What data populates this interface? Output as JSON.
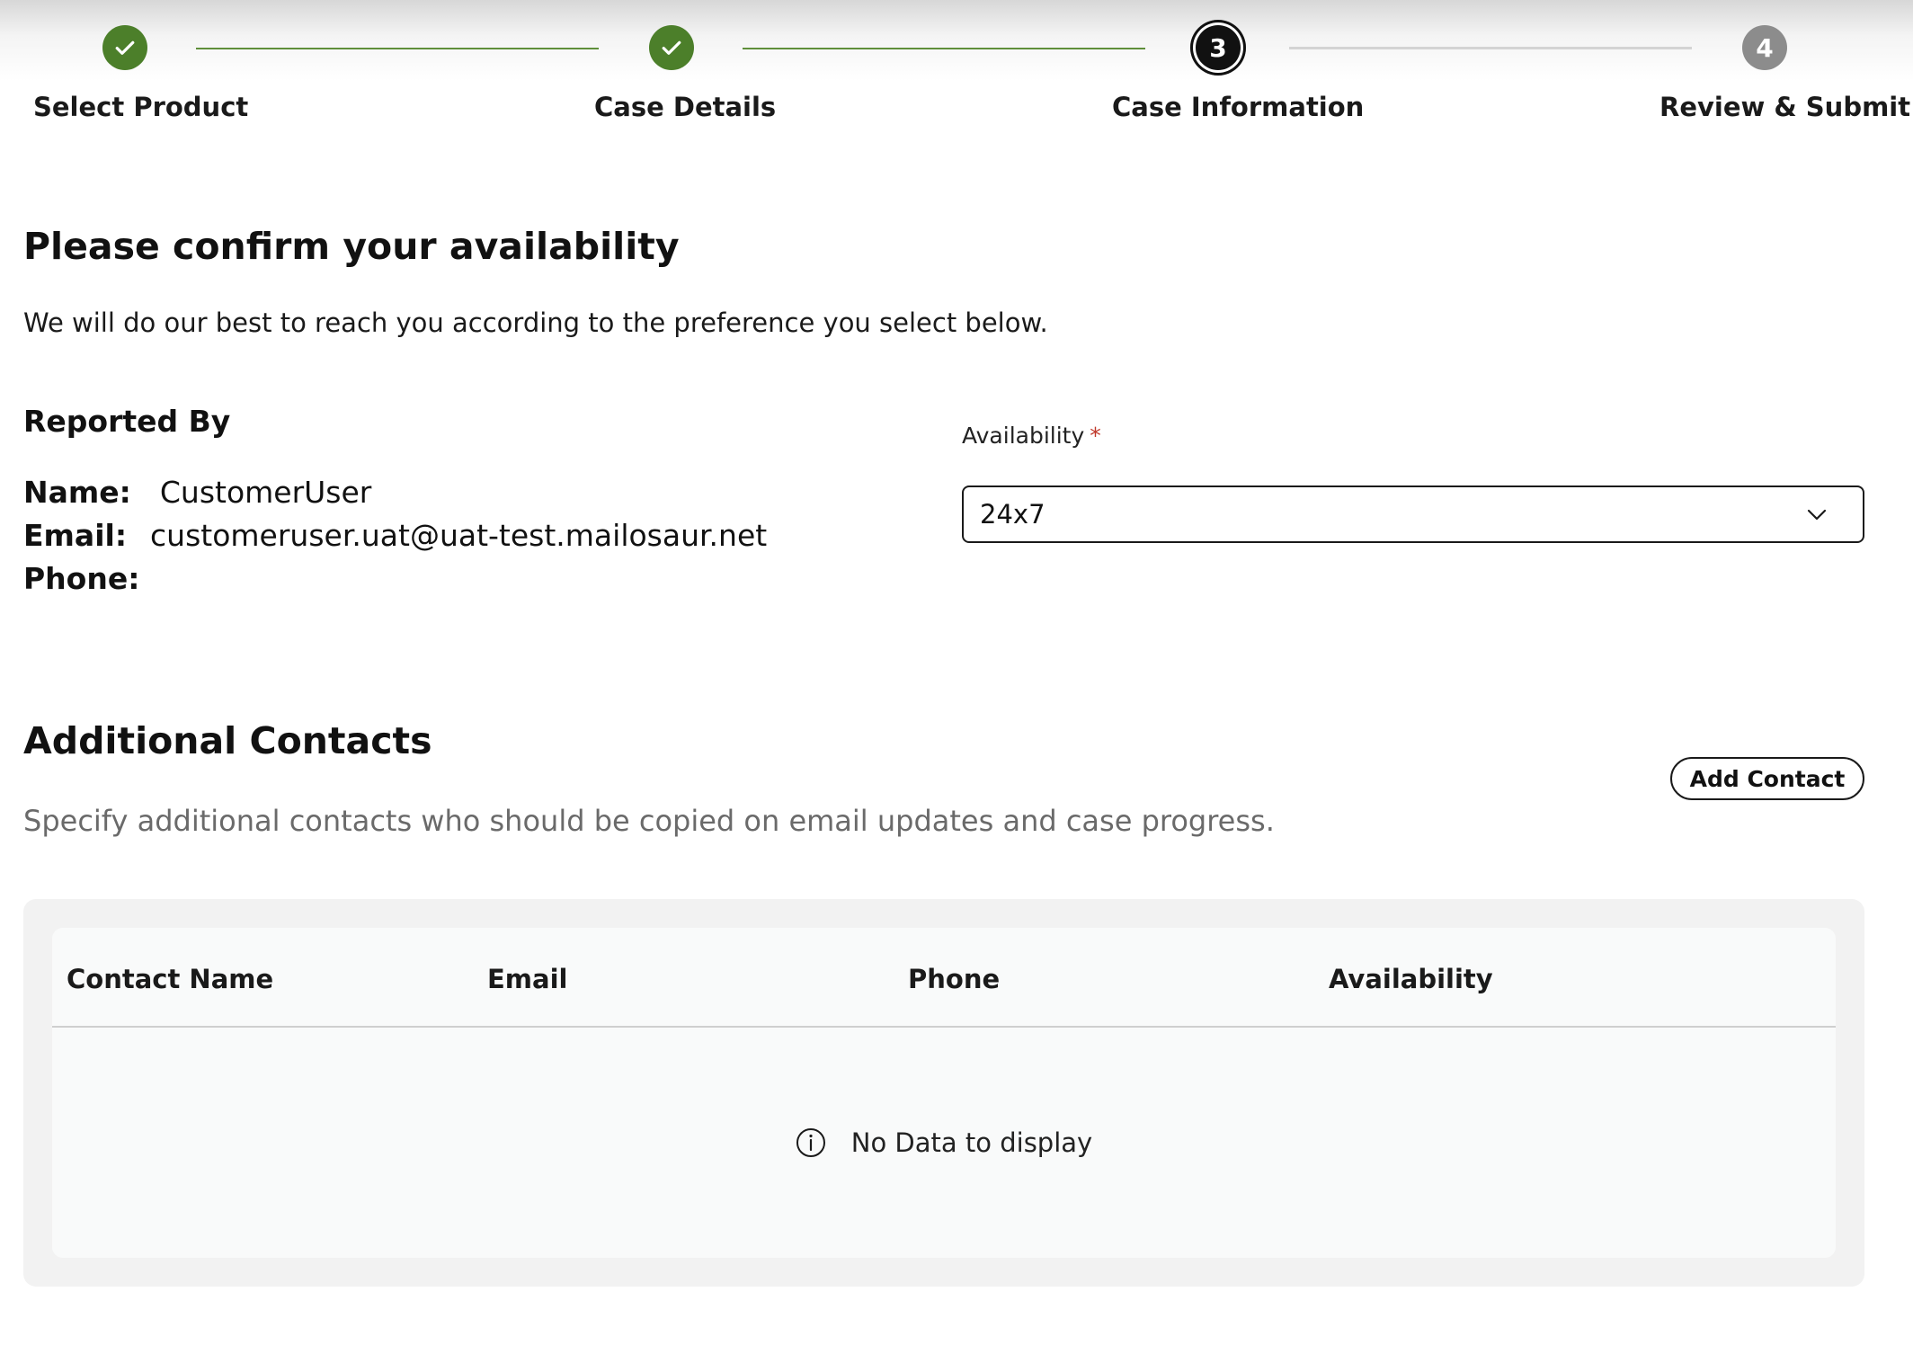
{
  "stepper": {
    "steps": [
      {
        "number": "1",
        "label": "Select Product",
        "state": "done"
      },
      {
        "number": "2",
        "label": "Case Details",
        "state": "done"
      },
      {
        "number": "3",
        "label": "Case Information",
        "state": "current"
      },
      {
        "number": "4",
        "label": "Review & Submit",
        "state": "todo"
      }
    ]
  },
  "availability_section": {
    "title": "Please confirm your availability",
    "subtitle": "We will do our best to reach you according to the preference you select below."
  },
  "reported_by": {
    "title": "Reported By",
    "name_label": "Name:",
    "name_value": "CustomerUser",
    "email_label": "Email:",
    "email_value": "customeruser.uat@uat-test.mailosaur.net",
    "phone_label": "Phone:",
    "phone_value": ""
  },
  "availability_field": {
    "label": "Availability",
    "required_marker": "*",
    "selected_value": "24x7"
  },
  "additional_contacts": {
    "title": "Additional Contacts",
    "description": "Specify additional contacts who should be copied on email updates and case progress.",
    "add_button_label": "Add Contact",
    "table": {
      "columns": [
        "Contact Name",
        "Email",
        "Phone",
        "Availability"
      ],
      "rows": [],
      "empty_message": "No Data to display"
    }
  },
  "colors": {
    "step_done": "#4c7f2a",
    "step_current": "#111111",
    "step_todo": "#8c8c8c",
    "required": "#c0392b"
  }
}
